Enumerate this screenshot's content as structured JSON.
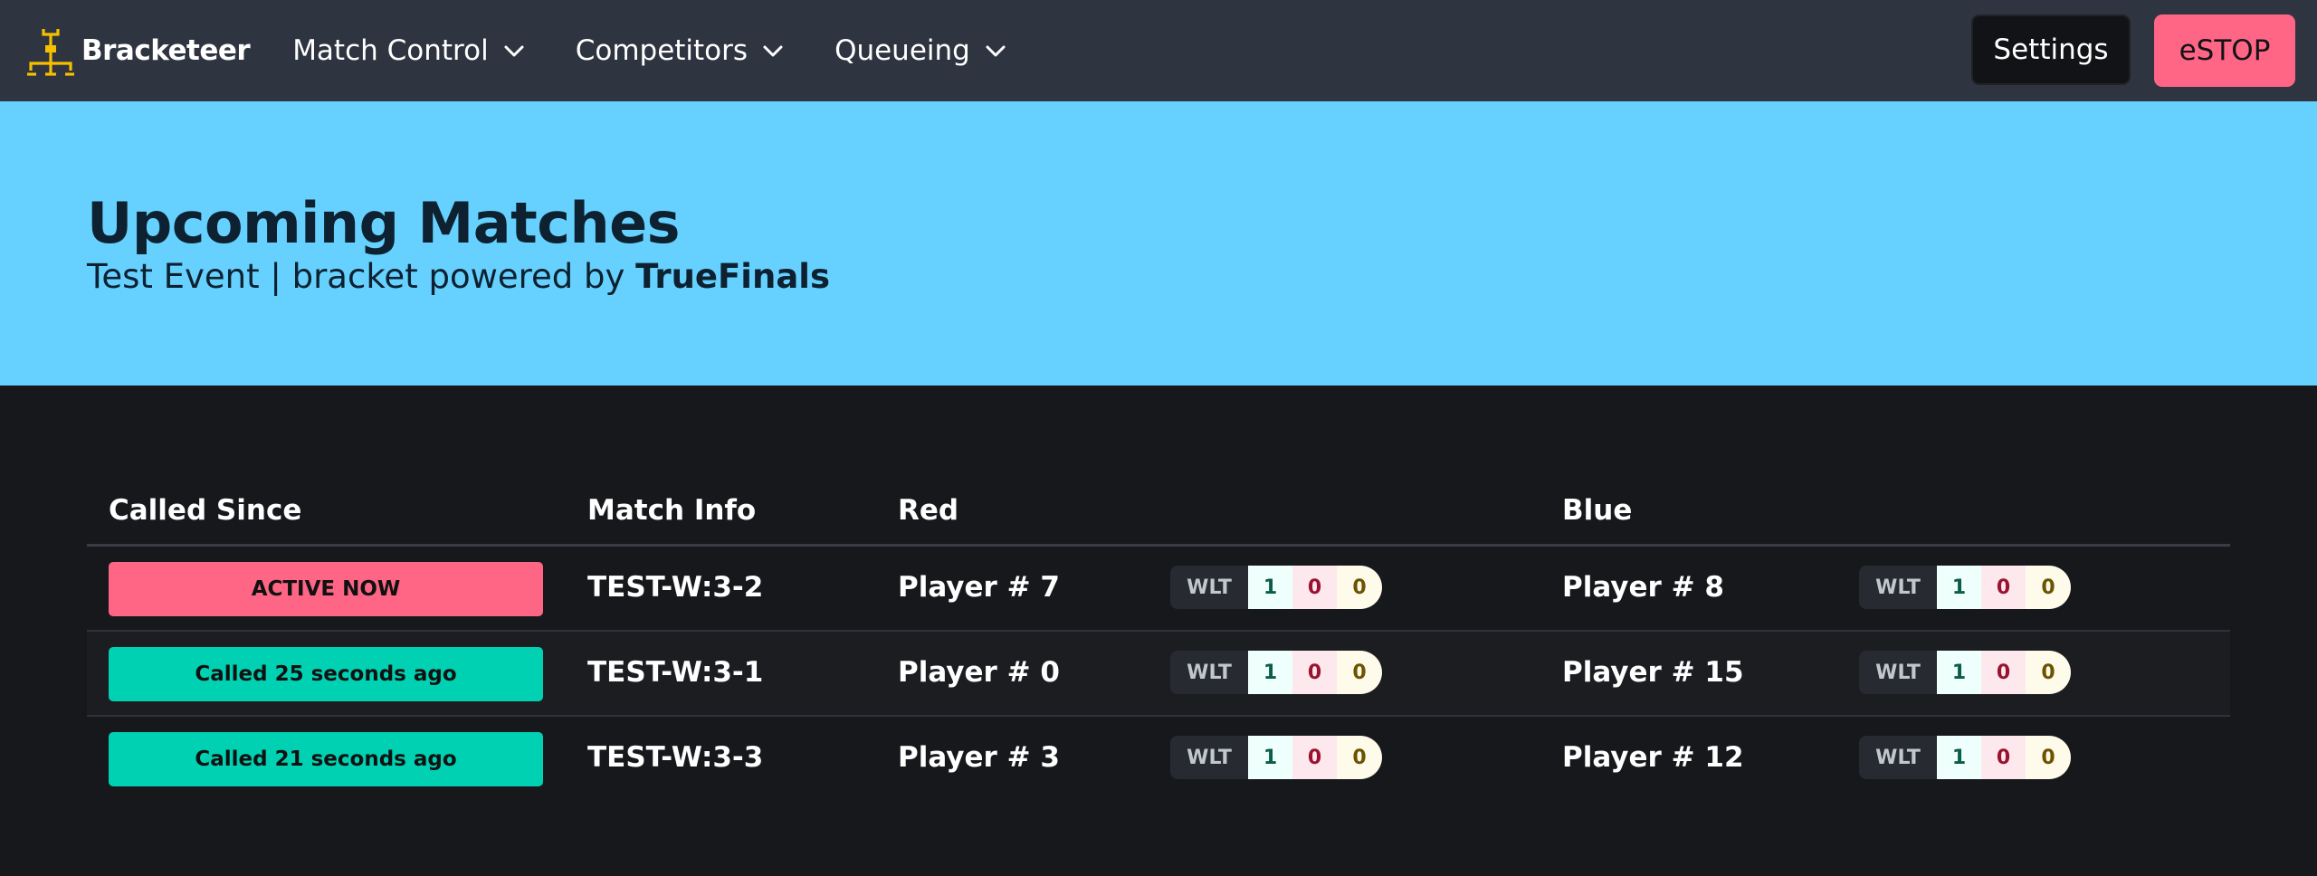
{
  "colors": {
    "navbar_bg": "#2f3441",
    "hero_bg": "#66d1ff",
    "page_bg": "#17181c",
    "active": "#ff6584",
    "called": "#00d1b2",
    "brand_icon": "#f5c000"
  },
  "navbar": {
    "brand": "Bracketeer",
    "brand_icon": "bracket-icon",
    "menus": [
      {
        "label": "Match Control"
      },
      {
        "label": "Competitors"
      },
      {
        "label": "Queueing"
      }
    ],
    "settings_label": "Settings",
    "estop_label": "eSTOP"
  },
  "hero": {
    "title": "Upcoming Matches",
    "subtitle_prefix": "Test Event | bracket powered by ",
    "subtitle_brand": "TrueFinals"
  },
  "table": {
    "headers": {
      "called_since": "Called Since",
      "match_info": "Match Info",
      "red": "Red",
      "blue": "Blue"
    },
    "rows": [
      {
        "status": "ACTIVE NOW",
        "status_kind": "active",
        "match": "TEST-W:3-2",
        "red": {
          "player": "Player # 7",
          "wlt_label": "WLT",
          "w": "1",
          "l": "0",
          "t": "0"
        },
        "blue": {
          "player": "Player # 8",
          "wlt_label": "WLT",
          "w": "1",
          "l": "0",
          "t": "0"
        }
      },
      {
        "status": "Called 25 seconds ago",
        "status_kind": "called",
        "match": "TEST-W:3-1",
        "red": {
          "player": "Player # 0",
          "wlt_label": "WLT",
          "w": "1",
          "l": "0",
          "t": "0"
        },
        "blue": {
          "player": "Player # 15",
          "wlt_label": "WLT",
          "w": "1",
          "l": "0",
          "t": "0"
        }
      },
      {
        "status": "Called 21 seconds ago",
        "status_kind": "called",
        "match": "TEST-W:3-3",
        "red": {
          "player": "Player # 3",
          "wlt_label": "WLT",
          "w": "1",
          "l": "0",
          "t": "0"
        },
        "blue": {
          "player": "Player # 12",
          "wlt_label": "WLT",
          "w": "1",
          "l": "0",
          "t": "0"
        }
      }
    ]
  }
}
